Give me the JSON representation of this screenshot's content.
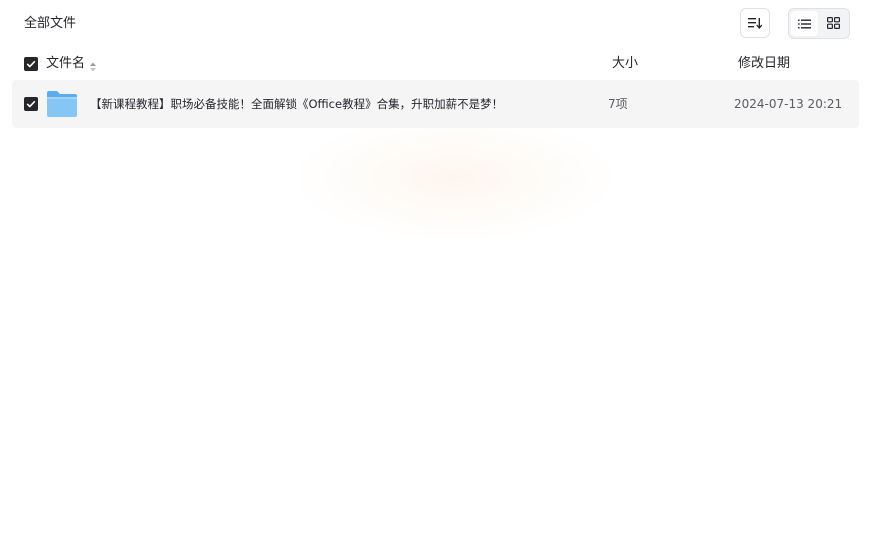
{
  "header": {
    "title": "全部文件"
  },
  "toolbar": {
    "sort_icon": "sort-icon",
    "view_modes": [
      {
        "name": "list",
        "icon": "list-view-icon",
        "active": true
      },
      {
        "name": "grid",
        "icon": "grid-view-icon",
        "active": false
      }
    ]
  },
  "table": {
    "columns": {
      "name": "文件名",
      "size": "大小",
      "date": "修改日期"
    },
    "select_all_checked": true,
    "rows": [
      {
        "checked": true,
        "icon": "folder-icon",
        "name": "【新课程教程】职场必备技能！全面解锁《Office教程》合集，升职加薪不是梦！",
        "size": "7项",
        "date": "2024-07-13 20:21"
      }
    ]
  },
  "colors": {
    "accent_dark": "#25262b",
    "row_bg": "#f5f5f6",
    "folder": "#7cc0f5",
    "border": "#dfe1e6"
  }
}
